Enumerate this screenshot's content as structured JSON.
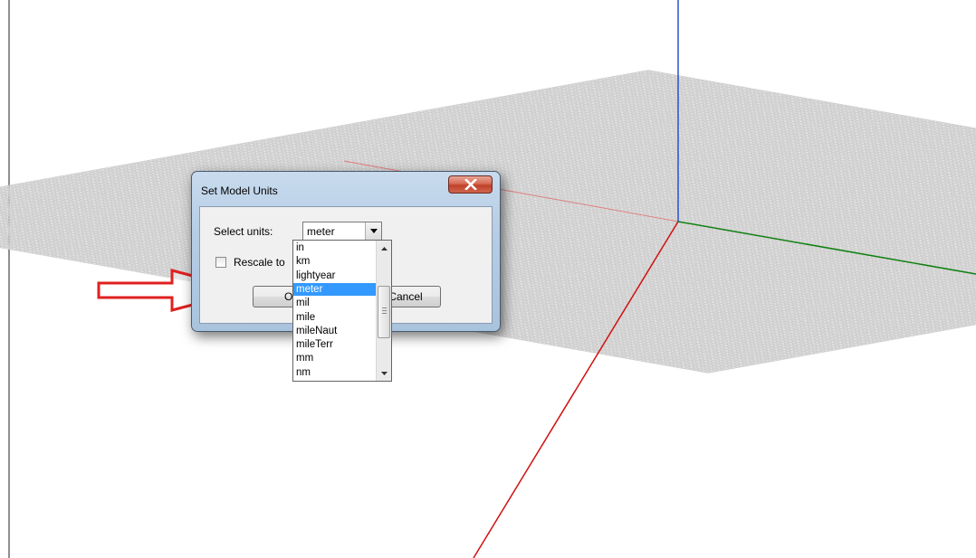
{
  "dialog": {
    "title": "Set Model Units",
    "select_label": "Select units:",
    "selected_unit": "meter",
    "rescale_label": "Rescale to model",
    "ok_label": "OK",
    "cancel_label": "Cancel",
    "close_icon": "close-icon"
  },
  "dropdown": {
    "options": [
      "in",
      "km",
      "lightyear",
      "meter",
      "mil",
      "mile",
      "mileNaut",
      "mileTerr",
      "mm",
      "nm"
    ],
    "selected": "meter",
    "highlight_color": "#3399ff"
  },
  "axes": {
    "x_color": "#d01010",
    "y_color": "#108010",
    "z_color": "#2a4fd0",
    "grid_color": "#cfcfcf"
  },
  "annotation": {
    "arrow_color": "#e02020",
    "icon": "right-arrow-icon"
  }
}
